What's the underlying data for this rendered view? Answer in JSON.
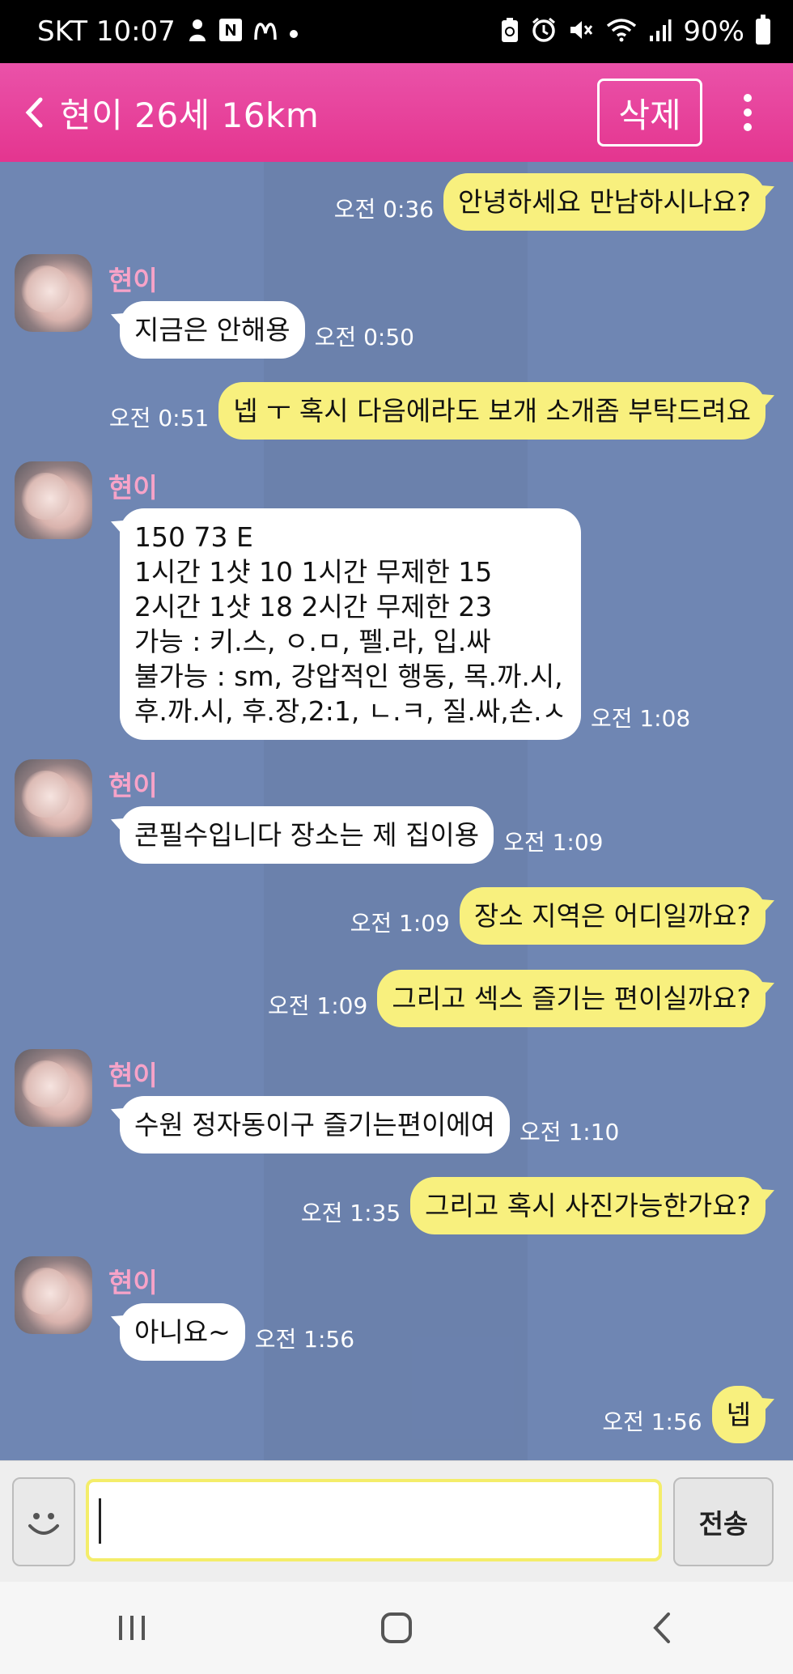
{
  "status_bar": {
    "carrier_time": "SKT 10:07",
    "notif_icons": [
      "person-icon",
      "n-icon",
      "m-icon",
      "dot-icon"
    ],
    "right_icons": [
      "recycle-icon",
      "alarm-icon",
      "mute-icon",
      "wifi-icon",
      "signal-icon"
    ],
    "battery": "90%"
  },
  "header": {
    "title": "현이 26세 16km",
    "delete_label": "삭제",
    "accent": "#e83f98"
  },
  "messages": [
    {
      "dir": "out",
      "text": "안녕하세요 만남하시나요?",
      "time": "오전 0:36"
    },
    {
      "dir": "in",
      "sender": "현이",
      "text": "지금은 안해용",
      "time": "오전 0:50"
    },
    {
      "dir": "out",
      "text": "넵 ㅜ 혹시 다음에라도 보개 소개좀 부탁드려요",
      "time": "오전 0:51"
    },
    {
      "dir": "in",
      "sender": "현이",
      "text": "150 73 E\n1시간 1샷 10 1시간 무제한 15\n2시간 1샷 18 2시간 무제한 23\n가능 : 키.스, ㅇ.ㅁ, 펠.라, 입.싸\n불가능 : sm, 강압적인 행동, 목.까.시,\n후.까.시, 후.장,2:1, ㄴ.ㅋ, 질.싸,손.ㅅ",
      "time": "오전 1:08"
    },
    {
      "dir": "in",
      "sender": "현이",
      "text": "콘필수입니다 장소는 제 집이용",
      "time": "오전 1:09"
    },
    {
      "dir": "out",
      "text": "장소 지역은 어디일까요?",
      "time": "오전 1:09"
    },
    {
      "dir": "out",
      "text": "그리고 섹스 즐기는 편이실까요?",
      "time": "오전 1:09"
    },
    {
      "dir": "in",
      "sender": "현이",
      "text": "수원 정자동이구 즐기는편이에여",
      "time": "오전 1:10"
    },
    {
      "dir": "out",
      "text": "그리고 혹시 사진가능한가요?",
      "time": "오전 1:35"
    },
    {
      "dir": "in",
      "sender": "현이",
      "text": "아니요~",
      "time": "오전 1:56"
    },
    {
      "dir": "out",
      "text": "넵",
      "time": "오전 1:56"
    }
  ],
  "input": {
    "value": "",
    "send_label": "전송"
  },
  "colors": {
    "chat_bg": "#6f86b3",
    "out_bubble": "#f8f07e",
    "in_bubble": "#ffffff",
    "sender_name": "#f7a3c8"
  },
  "nav": [
    "recents-icon",
    "home-icon",
    "back-icon"
  ]
}
